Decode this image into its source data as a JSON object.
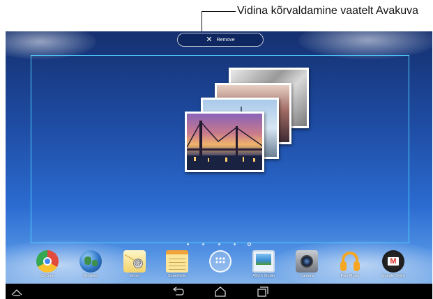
{
  "annotation": {
    "callout_text": "Vidina kõrvaldamine vaatelt Avakuva"
  },
  "top_bar": {
    "remove_label": "Remove",
    "remove_icon": "close-icon"
  },
  "widget": {
    "type": "photo-stack",
    "photo_count": 4,
    "frame_color": "#4fd0ff"
  },
  "home_pages": {
    "count": 5,
    "current_index": 4
  },
  "dock": {
    "apps": [
      {
        "label": "Chrome",
        "icon": "chrome-icon"
      },
      {
        "label": "Browser",
        "icon": "globe-icon"
      },
      {
        "label": "Email",
        "icon": "email-icon"
      },
      {
        "label": "SuperNote",
        "icon": "notepad-icon"
      },
      {
        "label": "",
        "icon": "app-drawer-icon"
      },
      {
        "label": "ASUS Studio",
        "icon": "gallery-icon"
      },
      {
        "label": "Camera",
        "icon": "camera-icon"
      },
      {
        "label": "Play Music",
        "icon": "headphones-icon"
      },
      {
        "label": "Google Settin",
        "icon": "gmail-icon"
      }
    ]
  },
  "navbar": {
    "left_icon": "chevron-up-icon",
    "back_icon": "back-icon",
    "home_icon": "home-icon",
    "recents_icon": "recents-icon"
  },
  "colors": {
    "sky_top": "#15306f",
    "sky_bottom": "#9cc3ee",
    "navbar": "#000000"
  }
}
